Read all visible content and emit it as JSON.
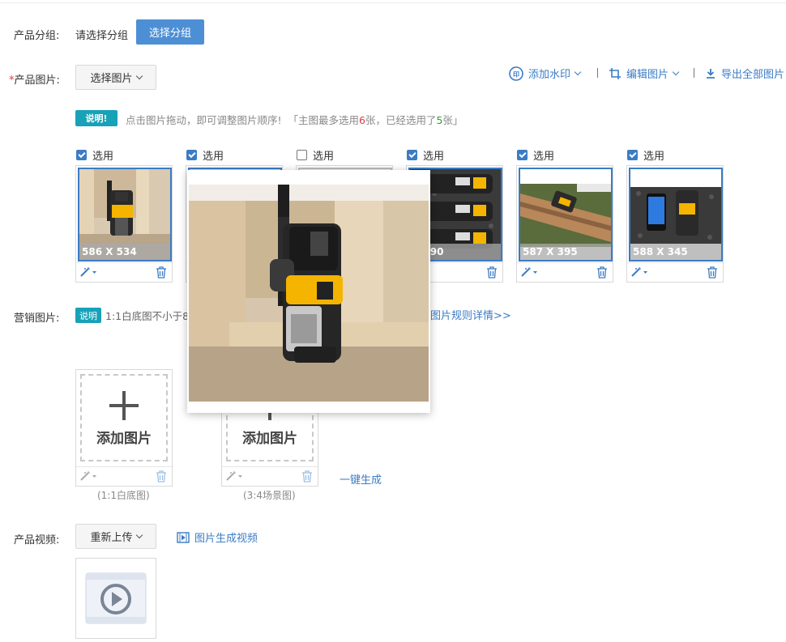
{
  "group": {
    "label": "产品分组:",
    "placeholder": "请选择分组",
    "button": "选择分组"
  },
  "images": {
    "required_mark": "*",
    "label": "产品图片:",
    "select_button": "选择图片",
    "actions": {
      "watermark": "添加水印",
      "edit": "编辑图片",
      "export": "导出全部图片"
    },
    "note": {
      "badge": "说明!",
      "text1": "点击图片拖动，即可调整图片顺序!",
      "text2": "「主图最多选用",
      "max": "6",
      "text3": "张，已经选用了",
      "used": "5",
      "text4": "张」"
    },
    "select_label": "选用",
    "items": [
      {
        "checked": true,
        "size": "586 X 534"
      },
      {
        "checked": true,
        "size": ""
      },
      {
        "checked": false,
        "size": ""
      },
      {
        "checked": true,
        "size": "X 590"
      },
      {
        "checked": true,
        "size": "587 X 395"
      },
      {
        "checked": true,
        "size": "588 X 345"
      }
    ]
  },
  "marketing": {
    "label": "营销图片:",
    "badge": "说明",
    "text": "1:1白底图不小于8",
    "rules_link": "图片规则详情>>",
    "add_text": "添加图片",
    "caption1": "(1:1白底图)",
    "caption2": "(3:4场景图)",
    "generate_link": "一键生成"
  },
  "video": {
    "label": "产品视频:",
    "reupload_button": "重新上传",
    "generate_link": "图片生成视频"
  },
  "colors": {
    "accent": "#3b7cc4",
    "button": "#4d8fd4",
    "badge": "#17a2b8",
    "red": "#e4393c",
    "green": "#2ca02c"
  }
}
